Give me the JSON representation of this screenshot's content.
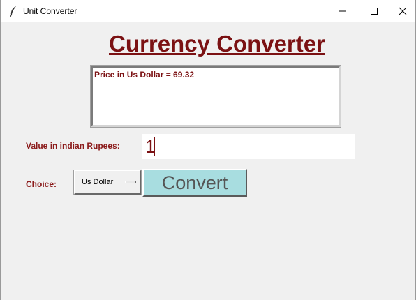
{
  "window": {
    "title": "Unit Converter",
    "icon": "feather-icon",
    "controls": {
      "minimize_icon": "minimize-icon",
      "maximize_icon": "maximize-icon",
      "close_icon": "close-icon"
    }
  },
  "main": {
    "heading": "Currency Converter",
    "output_text": "Price in Us Dollar = 69.32",
    "rupees_label": "Value in indian Rupees:",
    "rupees_value": "1",
    "choice_label": "Choice:",
    "choice_selected": "Us Dollar",
    "convert_label": "Convert"
  },
  "colors": {
    "label_text": "#7b1113",
    "convert_button_bg": "#a8dde0",
    "window_bg": "#f0f0f0"
  }
}
